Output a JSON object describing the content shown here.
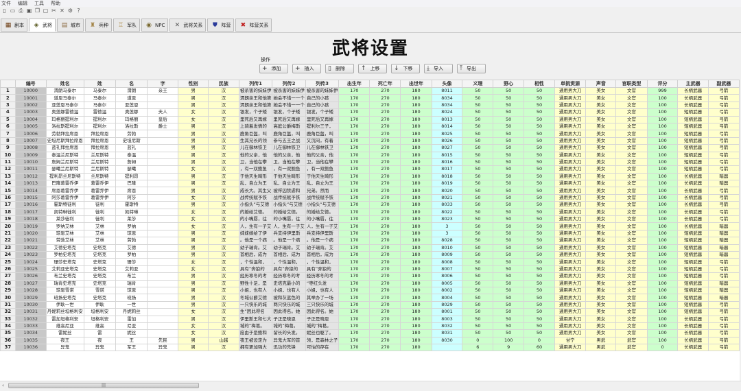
{
  "menu": [
    "文件",
    "编辑",
    "工具",
    "帮助"
  ],
  "toolbar_icons": [
    "new-file-icon",
    "open-folder-icon",
    "print-icon",
    "save-icon",
    "copy-icon",
    "paste-icon",
    "cut-icon",
    "delete-icon",
    "settings-icon",
    "help-icon"
  ],
  "tabs": [
    {
      "label": "剧本",
      "icon": "▦",
      "color": "#6b3a10"
    },
    {
      "label": "武将",
      "icon": "◈",
      "color": "#5a5a20"
    },
    {
      "label": "城市",
      "icon": "▤",
      "color": "#8a6a40"
    },
    {
      "label": "兵种",
      "icon": "♜",
      "color": "#a08040"
    },
    {
      "label": "军队",
      "icon": "♖",
      "color": "#b09050"
    },
    {
      "label": "NPC",
      "icon": "◉",
      "color": "#7a6a30"
    },
    {
      "label": "武将关系",
      "icon": "✕",
      "color": "#555"
    },
    {
      "label": "阵营",
      "icon": "⛊",
      "color": "#2a3a9a"
    },
    {
      "label": "阵营关系",
      "icon": "✖",
      "color": "#c02020"
    }
  ],
  "selected_tab": 1,
  "title": "武将设置",
  "ops_label": "操作",
  "buttons": [
    {
      "label": "添加",
      "icon": "+"
    },
    {
      "label": "插入",
      "icon": "+"
    },
    {
      "label": "删除",
      "icon": "▯"
    },
    {
      "label": "上移",
      "icon": "↑"
    },
    {
      "label": "下移",
      "icon": "↓"
    },
    {
      "label": "导入",
      "icon": "⤓"
    },
    {
      "label": "导出",
      "icon": "⤒"
    }
  ],
  "columns": [
    "",
    "编号",
    "姓名",
    "姓",
    "名",
    "字",
    "性别",
    "民族",
    "列传1",
    "列传2",
    "列传3",
    "出生年",
    "死亡年",
    "出世年",
    "头像",
    "义理",
    "野心",
    "相性",
    "单挑资源",
    "声音",
    "官职类型",
    "评分",
    "主武器",
    "副武器"
  ],
  "rows": [
    [
      "1",
      "10000",
      "渭朗马泰尔",
      "马泰尔",
      "渭朗",
      "亲王",
      "男",
      "汉",
      "被杀害的妹妹伊",
      "被杀害的妹妹伊",
      "被杀害的妹妹伊",
      "170",
      "270",
      "180",
      "8011",
      "50",
      "50",
      "50",
      "通用男大刀",
      "美女",
      "文官",
      "999",
      "长柄武器",
      "弓箭"
    ],
    [
      "2",
      "10001",
      "道恩马泰尔",
      "马泰尔",
      "道恩",
      "",
      "男",
      "汉",
      "渭朗亲王和他第",
      "她会不惜一一个",
      "自己的小孩",
      "170",
      "270",
      "180",
      "8034",
      "50",
      "50",
      "50",
      "通用男大刀",
      "美女",
      "文官",
      "100",
      "长柄武器",
      "弓箭"
    ],
    [
      "3",
      "10002",
      "亚莲恩马泰尔",
      "马泰尔",
      "亚莲恩",
      "",
      "男",
      "汉",
      "渭朗亲王和他第",
      "她会不惜一一个",
      "自己的小孩",
      "170",
      "270",
      "180",
      "8034",
      "50",
      "50",
      "50",
      "通用男大刀",
      "美女",
      "文官",
      "100",
      "长柄武器",
      "弓箭"
    ],
    [
      "4",
      "10003",
      "奥莲娜雷德温",
      "雷德温",
      "奥莲娜",
      "夫人",
      "女",
      "汉",
      "银发，个子矮",
      "银发，个子矮",
      "银发，个子矮",
      "170",
      "270",
      "180",
      "8024",
      "50",
      "50",
      "50",
      "通用男大刀",
      "美女",
      "文官",
      "100",
      "短柄武器",
      "弓箭"
    ],
    [
      "5",
      "10004",
      "玛格丽提利尔",
      "提利尔",
      "玛格丽",
      "皇后",
      "女",
      "汉",
      "里死后又再嫁",
      "里死后又再嫁",
      "里死后又再嫁",
      "170",
      "270",
      "180",
      "8013",
      "50",
      "50",
      "50",
      "通用男大刀",
      "美女",
      "文官",
      "100",
      "短柄武器",
      "弓箭"
    ],
    [
      "6",
      "10005",
      "洛拉斯提利尔",
      "提利尔",
      "洛拉斯",
      "爵士",
      "男",
      "汉",
      "上骑着发情的",
      "高庭公爵梅斯",
      "提利尔三子，",
      "170",
      "270",
      "180",
      "8014",
      "50",
      "50",
      "50",
      "通用男大刀",
      "美女",
      "文官",
      "100",
      "短柄武器",
      "弓箭"
    ],
    [
      "7",
      "10006",
      "劳勃拜拉席恩",
      "拜拉席恩",
      "劳勃",
      "",
      "男",
      "汉",
      "鹿角巨盔，叫",
      "鹿角巨盔，叫",
      "鹿角巨盔，叫",
      "170",
      "270",
      "180",
      "8025",
      "50",
      "50",
      "50",
      "通用男大刀",
      "美女",
      "文官",
      "100",
      "短柄武器",
      "弓箭"
    ],
    [
      "8",
      "10007",
      "史坦尼斯拜拉席恩",
      "拜拉席恩",
      "史坦尼斯",
      "",
      "男",
      "汉",
      "生其兄长的领",
      "参与五王之战",
      "又沉闷，有着",
      "170",
      "270",
      "180",
      "8026",
      "50",
      "50",
      "50",
      "通用男大刀",
      "美女",
      "文官",
      "100",
      "短柄武器",
      "弓箭"
    ],
    [
      "9",
      "10008",
      "蓝礼拜拉席恩",
      "拜拉席恩",
      "蓝礼",
      "",
      "男",
      "汉",
      "儿在御林铁卫",
      "儿在御林铁卫",
      "儿在御林铁卫",
      "170",
      "270",
      "180",
      "8027",
      "50",
      "50",
      "50",
      "通用男大刀",
      "美女",
      "文官",
      "100",
      "短柄武器",
      "弓箭"
    ],
    [
      "10",
      "10009",
      "泰温兰尼斯特",
      "兰尼斯特",
      "泰温",
      "",
      "男",
      "汉",
      "他的父亲，他",
      "他的父亲，他",
      "他的父亲，他",
      "170",
      "270",
      "180",
      "8015",
      "50",
      "50",
      "50",
      "通用男大刀",
      "美女",
      "文官",
      "100",
      "短柄武器",
      "弓箭"
    ],
    [
      "11",
      "10010",
      "詹姆兰尼斯特",
      "兰尼斯特",
      "詹姆",
      "",
      "男",
      "汉",
      "卫，当他在攀",
      "卫，当他在攀",
      "卫，当他在攀",
      "170",
      "270",
      "180",
      "8016",
      "50",
      "50",
      "50",
      "通用男大刀",
      "美女",
      "文官",
      "100",
      "短柄武器",
      "弓箭"
    ],
    [
      "12",
      "10011",
      "瑟曦兰尼斯特",
      "兰尼斯特",
      "瑟曦",
      "",
      "女",
      "汉",
      "，有一双鲍鱼",
      "，有一双鲍鱼",
      "，有一双鲍鱼",
      "170",
      "270",
      "180",
      "8017",
      "50",
      "50",
      "50",
      "通用男大刀",
      "美女",
      "文官",
      "100",
      "短柄武器",
      "弓箭"
    ],
    [
      "13",
      "10012",
      "提利昂兰尼斯特",
      "兰尼斯特",
      "提利昂",
      "",
      "男",
      "汉",
      "于他天生畸形",
      "于他天生畸形",
      "于他天生畸形",
      "170",
      "270",
      "180",
      "8018",
      "50",
      "50",
      "50",
      "通用男大刀",
      "美女",
      "文官",
      "100",
      "长柄武器",
      "暗器"
    ],
    [
      "14",
      "10013",
      "巴隆葛雷乔伊",
      "葛雷乔伊",
      "巴隆",
      "",
      "男",
      "汉",
      "乱，自立为王",
      "乱，自立为王",
      "乱，自立为王",
      "170",
      "270",
      "180",
      "8019",
      "50",
      "50",
      "50",
      "通用男大刀",
      "美女",
      "文官",
      "100",
      "长柄武器",
      "暗器"
    ],
    [
      "15",
      "10014",
      "席恩葛雷乔伊",
      "葛雷乔伊",
      "席恩",
      "",
      "男",
      "汉",
      "成长大。其生父",
      "被俘囚禁虐和",
      "兄弟。然而",
      "170",
      "270",
      "180",
      "8020",
      "50",
      "50",
      "50",
      "通用男大刀",
      "美女",
      "文官",
      "100",
      "长柄武器",
      "弓箭"
    ],
    [
      "16",
      "10015",
      "阿莎葛雷乔伊",
      "葛雷乔伊",
      "阿莎",
      "",
      "女",
      "汉",
      "战传统赋予铁",
      "战传统赋予铁",
      "战传统赋予铁",
      "170",
      "270",
      "180",
      "8021",
      "50",
      "50",
      "50",
      "通用男大刀",
      "美女",
      "文官",
      "100",
      "长柄武器",
      "弓箭"
    ],
    [
      "17",
      "10016",
      "霍斯特徒利",
      "徒利",
      "霍斯特",
      "",
      "男",
      "汉",
      "小指头”与艾德",
      "小指头”与艾德",
      "小指头”与艾德",
      "170",
      "270",
      "180",
      "8033",
      "50",
      "50",
      "50",
      "通用男大刀",
      "美女",
      "文官",
      "100",
      "长柄武器",
      "弓箭"
    ],
    [
      "18",
      "10017",
      "凯特琳徒利",
      "徒利",
      "凯特琳",
      "",
      "女",
      "汉",
      "的婚给艾德。",
      "的婚给艾德。",
      "的婚给艾德。",
      "170",
      "270",
      "180",
      "8022",
      "50",
      "50",
      "50",
      "通用男大刀",
      "美女",
      "文官",
      "100",
      "长柄武器",
      "弓箭"
    ],
    [
      "19",
      "10018",
      "莱莎徒利",
      "徒利",
      "莱莎",
      "",
      "女",
      "汉",
      "的小嘴唇，往",
      "的小嘴唇，往",
      "的小嘴唇，往",
      "170",
      "270",
      "180",
      "8023",
      "50",
      "50",
      "50",
      "通用男大刀",
      "美女",
      "文官",
      "100",
      "长柄武器",
      "弓箭"
    ],
    [
      "20",
      "10019",
      "罗纳艾林",
      "艾林",
      "罗纳",
      "",
      "女",
      "汉",
      "人，生有一子艾",
      "人，生有一子艾",
      "人，生有一子艾",
      "170",
      "270",
      "180",
      "3",
      "50",
      "50",
      "50",
      "通用男大刀",
      "美女",
      "文官",
      "100",
      "长柄武器",
      "暗器"
    ],
    [
      "21",
      "10020",
      "琼恩艾林",
      "艾林",
      "琼恩",
      "",
      "男",
      "汉",
      "妹妹嫁给了伊",
      "兵支持伊里斯",
      "兵支持伊里斯",
      "170",
      "270",
      "180",
      "3",
      "50",
      "50",
      "50",
      "通用男大刀",
      "美女",
      "文官",
      "100",
      "短柄武器",
      "暗器"
    ],
    [
      "22",
      "10021",
      "劳勃艾林",
      "艾林",
      "劳勃",
      "",
      "男",
      "汉",
      "。他是一个病",
      "。他是一个病",
      "。他是一个病",
      "170",
      "270",
      "180",
      "8028",
      "50",
      "50",
      "50",
      "通用男大刀",
      "美女",
      "文官",
      "100",
      "短柄武器",
      "暗器"
    ],
    [
      "23",
      "10022",
      "艾德史塔克",
      "史塔克",
      "艾德",
      "",
      "男",
      "汉",
      "幼子瑞肯。艾",
      "幼子瑞肯。艾",
      "幼子瑞肯。艾",
      "170",
      "270",
      "180",
      "8010",
      "50",
      "50",
      "50",
      "通用男大刀",
      "美女",
      "文官",
      "100",
      "短柄武器",
      "暗器"
    ],
    [
      "24",
      "10023",
      "罗柏史塔克",
      "史塔克",
      "罗柏",
      "",
      "男",
      "汉",
      "首相后，成为",
      "首相后，成为",
      "首相后，成为",
      "170",
      "270",
      "180",
      "8009",
      "50",
      "50",
      "50",
      "通用男大刀",
      "美女",
      "文官",
      "100",
      "短柄武器",
      "暗器"
    ],
    [
      "25",
      "10024",
      "珊莎史塔克",
      "史塔克",
      "珊莎",
      "",
      "女",
      "汉",
      "，个性温和，",
      "，个性温和，",
      "，个性温和，",
      "170",
      "270",
      "180",
      "8008",
      "50",
      "50",
      "50",
      "通用男大刀",
      "美女",
      "文官",
      "100",
      "短柄武器",
      "弓箭"
    ],
    [
      "26",
      "10025",
      "艾莉亚史塔克",
      "史塔克",
      "艾莉亚",
      "",
      "女",
      "汉",
      "具有“奔狼的",
      "具有“奔狼的",
      "具有“奔狼的",
      "170",
      "270",
      "180",
      "8007",
      "50",
      "50",
      "50",
      "通用男大刀",
      "美女",
      "文官",
      "100",
      "短柄武器",
      "弓箭"
    ],
    [
      "27",
      "10026",
      "布兰史塔克",
      "史塔克",
      "布兰",
      "",
      "男",
      "汉",
      "经历寒冬的考",
      "经历寒冬的考",
      "经历寒冬的考",
      "170",
      "270",
      "180",
      "8006",
      "50",
      "50",
      "50",
      "通用男大刀",
      "美女",
      "文官",
      "100",
      "短柄武器",
      "弓箭"
    ],
    [
      "28",
      "10027",
      "瑞肯史塔克",
      "史塔克",
      "瑞肯",
      "",
      "男",
      "汉",
      "野性十足，是",
      "史塔克最小的",
      "“枣红头发",
      "170",
      "270",
      "180",
      "8005",
      "50",
      "50",
      "50",
      "通用男大刀",
      "美女",
      "文官",
      "100",
      "短柄武器",
      "暗器"
    ],
    [
      "29",
      "10028",
      "琼恩雪诺",
      "雪诺",
      "琼恩",
      "",
      "男",
      "汉",
      "小姐，也有人",
      "小姐，也有人",
      "小姐，也有人",
      "170",
      "270",
      "180",
      "8002",
      "50",
      "50",
      "50",
      "通用男大刀",
      "美女",
      "文官",
      "100",
      "短柄武器",
      "暗器"
    ],
    [
      "30",
      "10029",
      "班扬史塔克",
      "史塔克",
      "班扬",
      "",
      "男",
      "汉",
      "冬城公爵艾德",
      "被和灰蓝色的",
      "其举办了一场",
      "170",
      "270",
      "180",
      "8004",
      "50",
      "50",
      "50",
      "通用男大刀",
      "美女",
      "文官",
      "100",
      "短柄武器",
      "暗器"
    ],
    [
      "31",
      "10030",
      "伊耿一世",
      "伊耿",
      "一世",
      "",
      "男",
      "汉",
      "一只快乐的城",
      "两只快乐的城",
      "三只快乐的城",
      "170",
      "270",
      "180",
      "8029",
      "50",
      "50",
      "50",
      "通用男大刀",
      "美女",
      "文官",
      "100",
      "短柄武器",
      "弓箭"
    ],
    [
      "32",
      "10031",
      "丹妮莉丝坦格利安",
      "坦格利安",
      "丹妮莉丝",
      "",
      "女",
      "汉",
      "生”因此得名",
      "因此得名。她",
      "因此得名。她",
      "170",
      "270",
      "180",
      "8001",
      "50",
      "50",
      "50",
      "通用男大刀",
      "美女",
      "文官",
      "100",
      "短柄武器",
      "弓箭"
    ],
    [
      "33",
      "10032",
      "雷加坦格利安",
      "坦格利安",
      "雷加",
      "",
      "男",
      "汉",
      "伊里斯王和七大",
      "子正是晓恩",
      "子正是晓恩",
      "170",
      "270",
      "180",
      "8003",
      "50",
      "50",
      "50",
      "通用男大刀",
      "美女",
      "文官",
      "100",
      "长柄武器",
      "弓箭"
    ],
    [
      "34",
      "10033",
      "维高尼亚",
      "维高",
      "尼亚",
      "",
      "女",
      "汉",
      "城的”梅葛。",
      "城的”梅葛。",
      "城的”梅葛。",
      "170",
      "270",
      "180",
      "8032",
      "50",
      "50",
      "50",
      "通用男大刀",
      "美女",
      "文官",
      "100",
      "长柄武器",
      "弓箭"
    ],
    [
      "35",
      "10034",
      "雷妮丝",
      "雷",
      "妮丝",
      "",
      "女",
      "汉",
      "庞由于是鲍和",
      "留长的头发。",
      "妮丝也駆了。",
      "170",
      "270",
      "180",
      "8031",
      "50",
      "50",
      "50",
      "通用男大刀",
      "美女",
      "文官",
      "100",
      "长柄武器",
      "弓箭"
    ],
    [
      "36",
      "10035",
      "夜王",
      "夜",
      "王",
      "先民",
      "男",
      "山越",
      "夜王被设定为",
      "异鬼大军的首",
      "领，是森林之子",
      "170",
      "270",
      "180",
      "8030",
      "0",
      "100",
      "0",
      "甘宁",
      "男武",
      "武官",
      "100",
      "长柄武器",
      "弓箭"
    ],
    [
      "37",
      "10036",
      "异鬼",
      "异鬼",
      "军王",
      "异鬼",
      "男",
      "汉",
      "拥有更加强大",
      "迅功的先锋",
      "可怕的存在",
      "170",
      "270",
      "180",
      "",
      "6",
      "9",
      "60",
      "通用男大刀",
      "男武",
      "武官",
      "0",
      "长柄武器",
      "弓箭"
    ]
  ],
  "hscroll_grip": "|||"
}
